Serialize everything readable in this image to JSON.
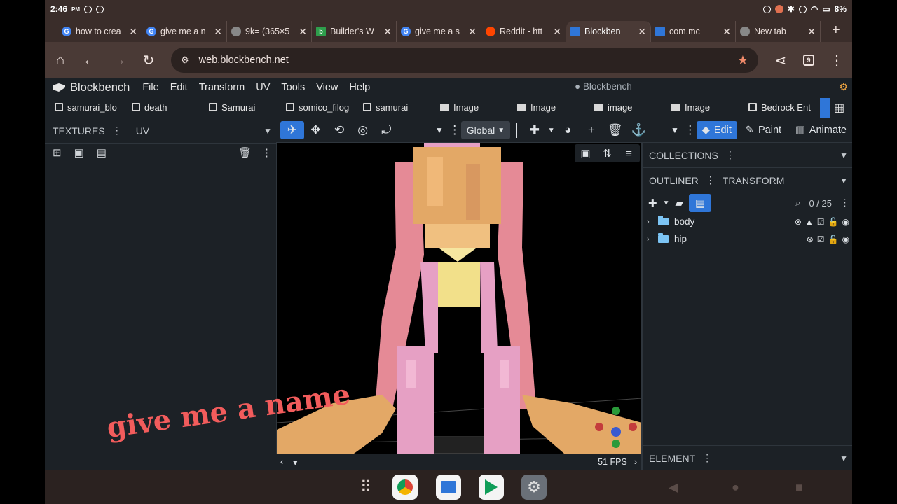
{
  "status_bar": {
    "time": "2:46",
    "ampm": "PM",
    "battery": "8%"
  },
  "browser": {
    "tabs": [
      {
        "label": "how to crea",
        "favicon": "google-icon",
        "color": "#4285f4"
      },
      {
        "label": "give me a n",
        "favicon": "google-icon",
        "color": "#4285f4"
      },
      {
        "label": "9k= (365×5",
        "favicon": "image-icon",
        "color": "#888888"
      },
      {
        "label": "Builder's W",
        "favicon": "bl-icon",
        "color": "#2e9e4c"
      },
      {
        "label": "give me a s",
        "favicon": "google-icon",
        "color": "#4285f4"
      },
      {
        "label": "Reddit - htt",
        "favicon": "reddit-icon",
        "color": "#ff4500"
      },
      {
        "label": "Blockben",
        "favicon": "blockbench-icon",
        "color": "#2f76d8"
      },
      {
        "label": "com.mc",
        "favicon": "files-icon",
        "color": "#2f76d8"
      },
      {
        "label": "New tab",
        "favicon": "chrome-icon",
        "color": "#888888"
      }
    ],
    "url": "web.blockbench.net",
    "tab_count": "9"
  },
  "blockbench": {
    "app_name": "Blockbench",
    "menu": [
      "File",
      "Edit",
      "Transform",
      "UV",
      "Tools",
      "View",
      "Help"
    ],
    "window_title": "● Blockbench",
    "project_tabs": [
      {
        "label": "samurai_blo",
        "kind": "model"
      },
      {
        "label": "death",
        "kind": "model"
      },
      {
        "label": "Samurai",
        "kind": "model"
      },
      {
        "label": "somico_filog",
        "kind": "model"
      },
      {
        "label": "samurai",
        "kind": "model"
      },
      {
        "label": "Image",
        "kind": "image"
      },
      {
        "label": "Image",
        "kind": "image"
      },
      {
        "label": "image",
        "kind": "image"
      },
      {
        "label": "Image",
        "kind": "image"
      },
      {
        "label": "Bedrock Ent",
        "kind": "model"
      }
    ],
    "left_panel": {
      "tab_textures": "TEXTURES",
      "tab_uv": "UV"
    },
    "toolbar": {
      "space": "Global",
      "modes": [
        "Edit",
        "Paint",
        "Animate"
      ]
    },
    "viewport": {
      "fps": "51 FPS"
    },
    "right_panel": {
      "collections": "COLLECTIONS",
      "outliner": "OUTLINER",
      "transform": "TRANSFORM",
      "count": "0 / 25",
      "groups": [
        {
          "name": "body"
        },
        {
          "name": "hip"
        }
      ],
      "element": "ELEMENT"
    }
  },
  "overlay_caption": "give me a name",
  "colors": {
    "accent": "#2f76d8",
    "caption": "#f25c5c",
    "skin": "#e3a866",
    "pink": "#e58a96",
    "light_pink": "#e6a0c4",
    "yellow": "#f2e08a"
  }
}
